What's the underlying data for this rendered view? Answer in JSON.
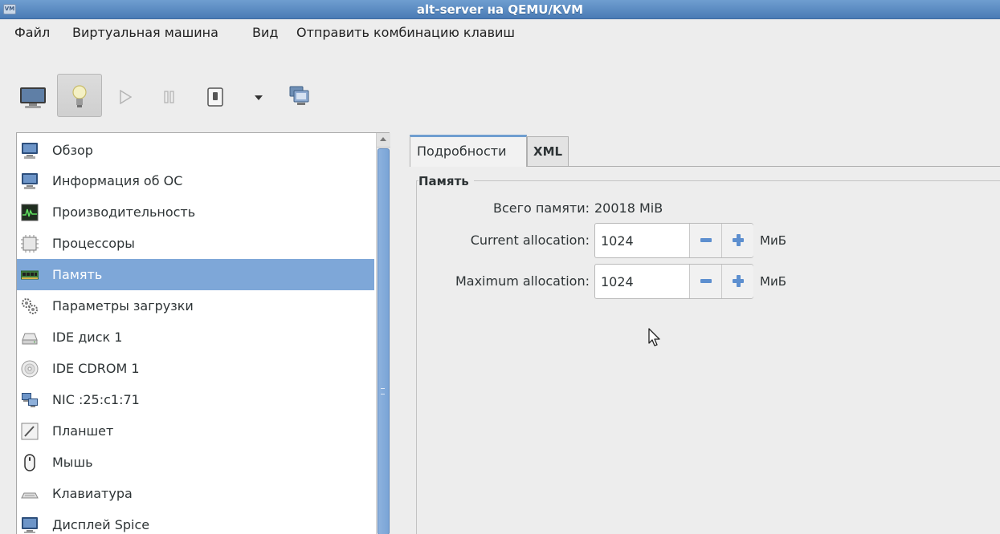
{
  "window": {
    "title": "alt-server на QEMU/KVM",
    "icon_text": "VM"
  },
  "menu": {
    "file": "Файл",
    "vm": "Виртуальная машина",
    "view": "Вид",
    "send_key": "Отправить комбинацию клавиш"
  },
  "toolbar": {
    "icons": [
      "monitor-icon",
      "lightbulb-icon",
      "play-icon",
      "pause-icon",
      "power-icon",
      "dropdown-arrow-icon",
      "snapshots-icon"
    ],
    "active": "lightbulb-icon"
  },
  "sidebar": {
    "items": [
      {
        "label": "Обзор",
        "icon": "monitor-icon"
      },
      {
        "label": "Информация об ОС",
        "icon": "monitor-icon"
      },
      {
        "label": "Производительность",
        "icon": "performance-graph-icon"
      },
      {
        "label": "Процессоры",
        "icon": "cpu-chip-icon"
      },
      {
        "label": "Память",
        "icon": "memory-module-icon",
        "selected": true
      },
      {
        "label": "Параметры загрузки",
        "icon": "gears-icon"
      },
      {
        "label": "IDE диск 1",
        "icon": "hard-disk-icon"
      },
      {
        "label": "IDE CDROM 1",
        "icon": "cdrom-icon"
      },
      {
        "label": "NIC :25:c1:71",
        "icon": "network-card-icon"
      },
      {
        "label": "Планшет",
        "icon": "tablet-icon"
      },
      {
        "label": "Мышь",
        "icon": "mouse-icon"
      },
      {
        "label": "Клавиатура",
        "icon": "keyboard-icon"
      },
      {
        "label": "Дисплей Spice",
        "icon": "display-icon"
      }
    ]
  },
  "tabs": {
    "details": "Подробности",
    "xml": "XML"
  },
  "memory": {
    "section_title": "Память",
    "total_label": "Всего памяти:",
    "total_value": "20018 MiB",
    "current_label": "Current allocation:",
    "current_value": "1024",
    "max_label": "Maximum allocation:",
    "max_value": "1024",
    "unit": "МиБ"
  },
  "colors": {
    "selection": "#7ea7d8",
    "titlebar": "#4a7bb5",
    "accent": "#5d8fcf"
  }
}
